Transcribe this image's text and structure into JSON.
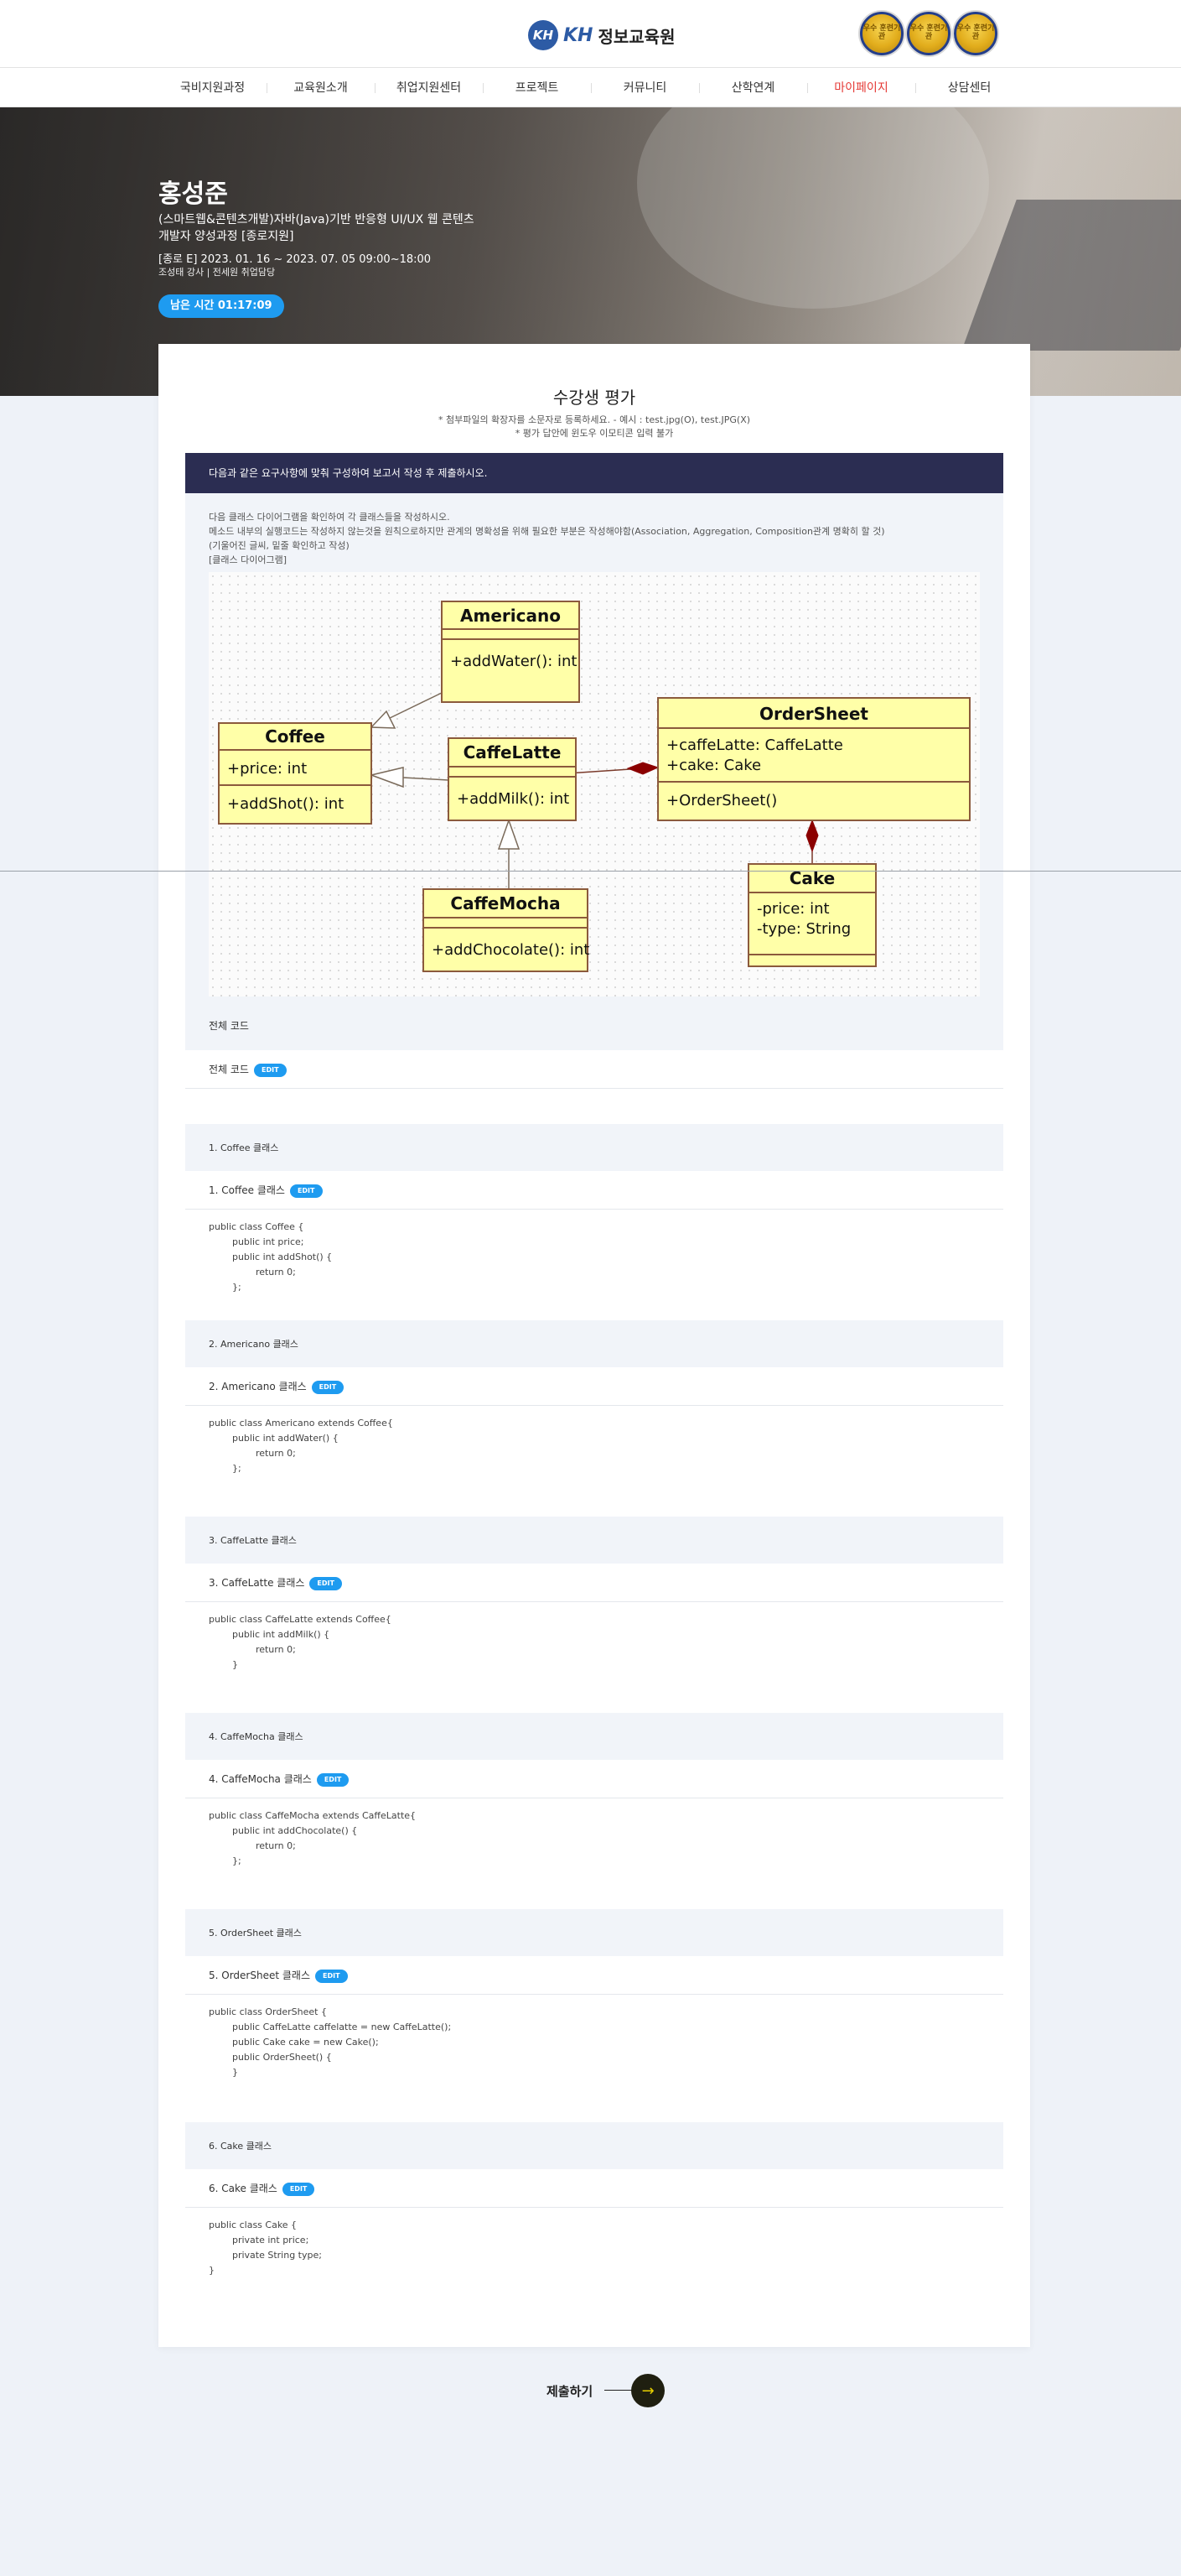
{
  "header": {
    "logo_mark": "KH",
    "logo_kh": "KH",
    "logo_text": "정보교육원",
    "medals": [
      "우수 훈련기관",
      "우수 훈련기관",
      "우수 훈련기관"
    ]
  },
  "nav": {
    "items": [
      "국비지원과정",
      "교육원소개",
      "취업지원센터",
      "프로젝트",
      "커뮤니티",
      "산학연계",
      "마이페이지",
      "상담센터"
    ],
    "active_index": 6
  },
  "hero": {
    "name": "홍성준",
    "course": "(스마트웹&콘텐츠개발)자바(Java)기반 반응형 UI/UX 웹 콘텐츠 개발자 양성과정 [종로지원]",
    "period": "[종로 E] 2023. 01. 16 ~ 2023. 07. 05 09:00~18:00",
    "teacher": "조성태 강사 | 전세원 취업담당",
    "timer": "남은 시간 01:17:09"
  },
  "card": {
    "title": "수강생 평가",
    "note1": "* 첨부파일의 확장자를 소문자로 등록하세요. - 예시 : test.jpg(O), test.JPG(X)",
    "note2": "* 평가 답안에 윈도우 이모티콘 입력 불가",
    "question_header": "다음과 같은 요구사항에 맞춰 구성하여 보고서 작성 후 제출하시오.",
    "question_lines": [
      "다음 클래스 다이어그램을 확인하여 각 클래스들을 작성하시오.",
      "메소드 내부의 실행코드는 작성하지 않는것을 원칙으로하지만 관계의 명확성을 위해 필요한 부분은 작성해야함(Association, Aggregation, Composition관계 명확히 할 것)",
      "(기울어진 글씨, 밑줄 확인하고 작성)",
      "[클래스 다이어그램]"
    ],
    "full_code_label": "전체 코드",
    "full_code_edit_label": "전체 코드",
    "edit_badge": "EDIT"
  },
  "diagram": {
    "classes": [
      {
        "name": "Americano",
        "attributes": [],
        "methods": [
          "+addWater(): int"
        ]
      },
      {
        "name": "Coffee",
        "attributes": [
          "+price: int"
        ],
        "methods": [
          "+addShot(): int"
        ]
      },
      {
        "name": "CaffeLatte",
        "attributes": [],
        "methods": [
          "+addMilk(): int"
        ]
      },
      {
        "name": "OrderSheet",
        "attributes": [
          "+caffeLatte: CaffeLatte",
          "+cake: Cake"
        ],
        "methods": [
          "+OrderSheet()"
        ]
      },
      {
        "name": "CaffeMocha",
        "attributes": [],
        "methods": [
          "+addChocolate(): int"
        ]
      },
      {
        "name": "Cake",
        "attributes": [
          "-price: int",
          "-type: String"
        ],
        "methods": []
      }
    ],
    "colors": {
      "fill": "#ffffa8",
      "stroke": "#8b5a3c",
      "composition": "#8b0000",
      "arrow": "#7a6a5a"
    }
  },
  "sections": [
    {
      "title": "1. Coffee 클래스",
      "edit_label": "1. Coffee 클래스",
      "code": "public class Coffee {\n        public int price;\n        public int addShot() {\n                return 0;\n        };"
    },
    {
      "title": "2. Americano 클래스",
      "edit_label": "2. Americano 클래스",
      "code": "public class Americano extends Coffee{\n        public int addWater() {\n                return 0;\n        };"
    },
    {
      "title": "3. CaffeLatte 클래스",
      "edit_label": "3. CaffeLatte 클래스",
      "code": "public class CaffeLatte extends Coffee{\n        public int addMilk() {\n                return 0;\n        }"
    },
    {
      "title": "4. CaffeMocha 클래스",
      "edit_label": "4. CaffeMocha 클래스",
      "code": "public class CaffeMocha extends CaffeLatte{\n        public int addChocolate() {\n                return 0;\n        };"
    },
    {
      "title": "5. OrderSheet 클래스",
      "edit_label": "5. OrderSheet 클래스",
      "code": "public class OrderSheet {\n        public CaffeLatte caffelatte = new CaffeLatte();\n        public Cake cake = new Cake();\n        public OrderSheet() {\n        }"
    },
    {
      "title": "6. Cake 클래스",
      "edit_label": "6. Cake 클래스",
      "code": "public class Cake {\n        private int price;\n        private String type;\n}"
    }
  ],
  "submit": {
    "label": "제출하기",
    "arrow": "→"
  }
}
